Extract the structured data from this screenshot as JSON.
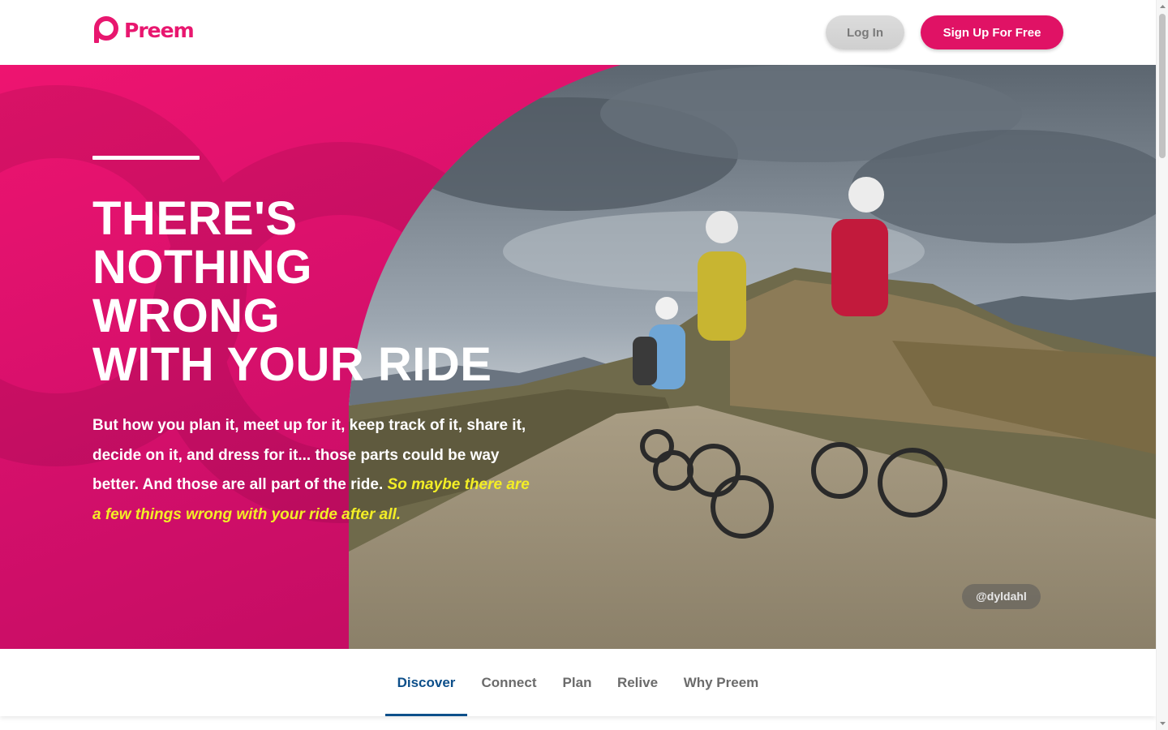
{
  "header": {
    "logo_text": "Preem",
    "login_label": "Log In",
    "signup_label": "Sign Up For Free"
  },
  "hero": {
    "title_lines": [
      "THERE'S",
      "NOTHING",
      "WRONG",
      "WITH YOUR RIDE"
    ],
    "body": "But how you plan it, meet up for it, keep track of it, share it, decide on it, and dress for it... those parts could be way better. And those are all part of the ride. ",
    "highlight": "So maybe there are a few things wrong with your ride after all.",
    "photo_credit": "@dyldahl"
  },
  "tabs": [
    {
      "label": "Discover",
      "active": true
    },
    {
      "label": "Connect",
      "active": false
    },
    {
      "label": "Plan",
      "active": false
    },
    {
      "label": "Relive",
      "active": false
    },
    {
      "label": "Why Preem",
      "active": false
    }
  ],
  "colors": {
    "brand_pink": "#e01265",
    "highlight_yellow": "#f3ee26",
    "tab_active": "#0d4f8a"
  },
  "icons": {
    "logo": "preem-p-logo-icon",
    "scroll_up": "chevron-up-icon",
    "scroll_down": "chevron-down-icon"
  }
}
